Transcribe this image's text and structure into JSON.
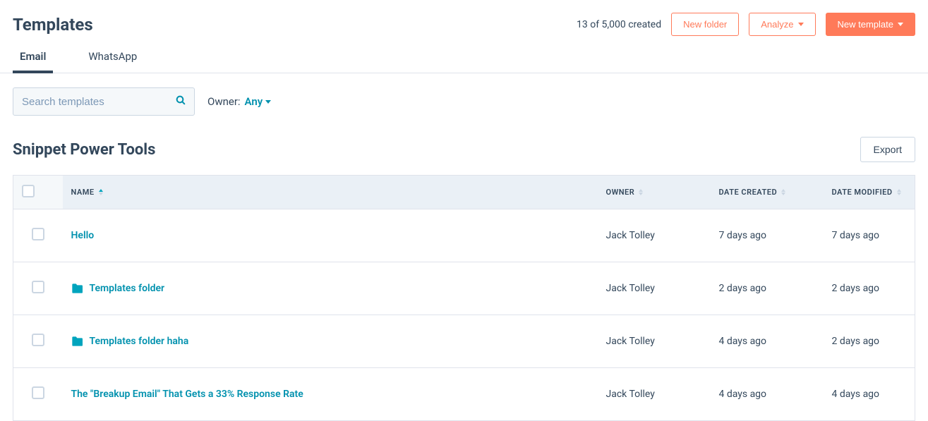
{
  "header": {
    "title": "Templates",
    "count_text": "13 of 5,000 created",
    "new_folder": "New folder",
    "analyze": "Analyze",
    "new_template": "New template"
  },
  "tabs": {
    "email": "Email",
    "whatsapp": "WhatsApp"
  },
  "filters": {
    "search_placeholder": "Search templates",
    "owner_label": "Owner:",
    "owner_value": "Any"
  },
  "section": {
    "title": "Snippet Power Tools",
    "export": "Export"
  },
  "columns": {
    "name": "Name",
    "owner": "Owner",
    "created": "Date Created",
    "modified": "Date Modified"
  },
  "rows": [
    {
      "name": "Hello",
      "is_folder": false,
      "owner": "Jack Tolley",
      "created": "7 days ago",
      "modified": "7 days ago"
    },
    {
      "name": "Templates folder",
      "is_folder": true,
      "owner": "Jack Tolley",
      "created": "2 days ago",
      "modified": "2 days ago"
    },
    {
      "name": "Templates folder haha",
      "is_folder": true,
      "owner": "Jack Tolley",
      "created": "4 days ago",
      "modified": "2 days ago"
    },
    {
      "name": "The \"Breakup Email\" That Gets a 33% Response Rate",
      "is_folder": false,
      "owner": "Jack Tolley",
      "created": "4 days ago",
      "modified": "4 days ago"
    }
  ]
}
